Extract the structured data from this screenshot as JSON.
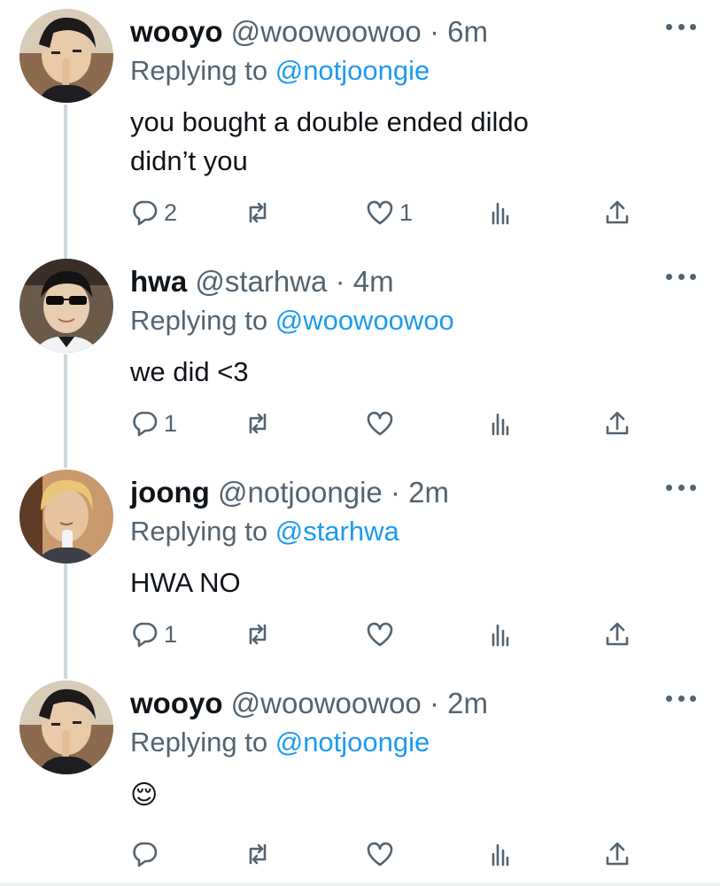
{
  "tweets": [
    {
      "name": "wooyo",
      "handle": "@woowoowoo",
      "dot": "·",
      "time": "6m",
      "replying_prefix": "Replying to ",
      "replying_to": "@notjoongie",
      "text_lines": [
        "you bought a double ended dildo",
        "didn’t you"
      ],
      "counts": {
        "reply": "2",
        "retweet": "",
        "like": "1"
      }
    },
    {
      "name": "hwa",
      "handle": "@starhwa",
      "dot": "·",
      "time": "4m",
      "replying_prefix": "Replying to ",
      "replying_to": "@woowoowoo",
      "text_lines": [
        "we did <3"
      ],
      "counts": {
        "reply": "1",
        "retweet": "",
        "like": ""
      }
    },
    {
      "name": "joong",
      "handle": "@notjoongie",
      "dot": "·",
      "time": "2m",
      "replying_prefix": "Replying to ",
      "replying_to": "@starhwa",
      "text_lines": [
        "HWA NO"
      ],
      "counts": {
        "reply": "1",
        "retweet": "",
        "like": ""
      }
    },
    {
      "name": "wooyo",
      "handle": "@woowoowoo",
      "dot": "·",
      "time": "2m",
      "replying_prefix": "Replying to ",
      "replying_to": "@notjoongie",
      "emoji": "😌",
      "counts": {
        "reply": "",
        "retweet": "",
        "like": ""
      }
    }
  ],
  "colors": {
    "text": "#0f1419",
    "muted": "#536471",
    "link": "#1d9bf0",
    "thread_line": "#cfd9de"
  },
  "icons": {
    "reply": "speech-bubble-icon",
    "retweet": "retweet-arrows-icon",
    "like": "heart-outline-icon",
    "views": "bar-chart-icon",
    "share": "share-upload-icon",
    "more": "three-dots-icon"
  }
}
